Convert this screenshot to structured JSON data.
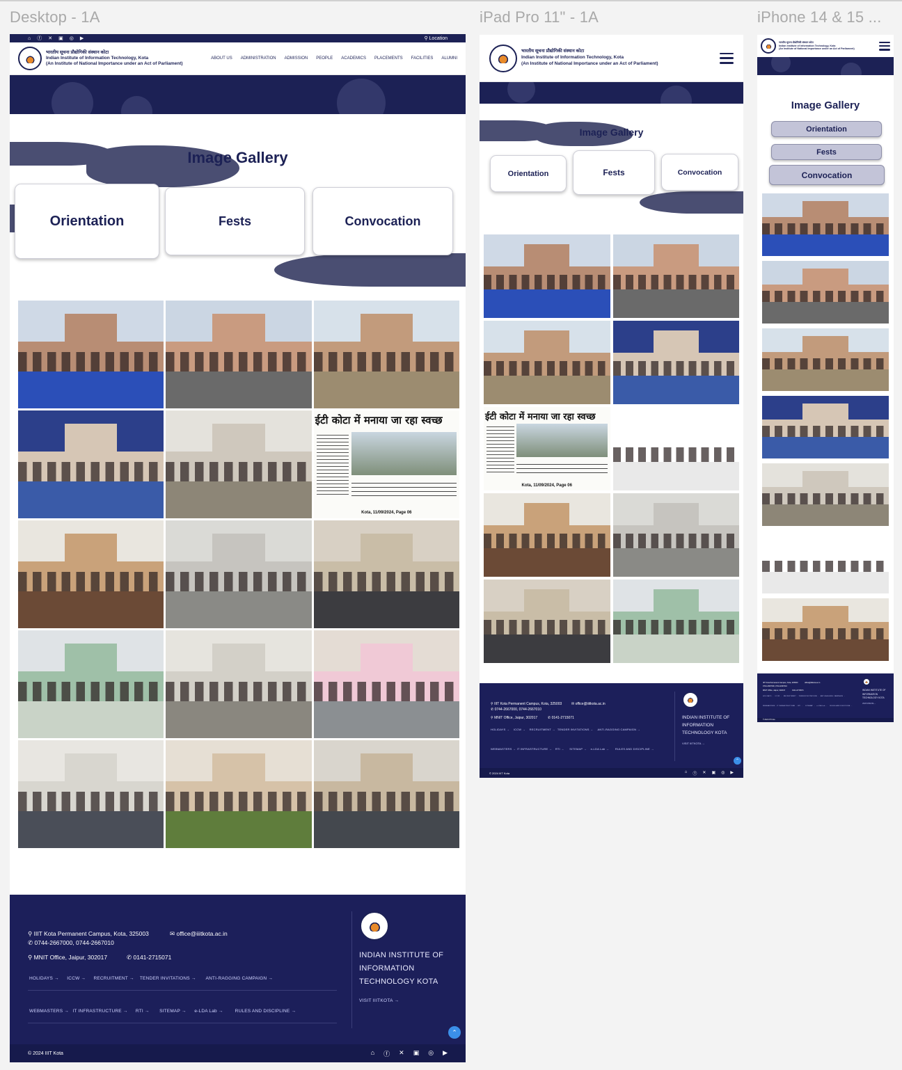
{
  "frames": {
    "desktop": "Desktop - 1A",
    "ipad": "iPad Pro 11\" - 1A",
    "iphone": "iPhone 14 & 15 ..."
  },
  "topbar": {
    "location": "Location"
  },
  "institute": {
    "hindi": "भारतीय सूचना प्रौद्योगिकी संस्थान कोटा",
    "english": "Indian Institute of Information Technology, Kota",
    "tagline": "(An Institute of National Importance under an Act of Parliament)"
  },
  "nav": [
    "ABOUT US",
    "ADMINISTRATION",
    "ADMISSION",
    "PEOPLE",
    "ACADEMICS",
    "PLACEMENTS",
    "FACILITIES",
    "ALUMNI"
  ],
  "gallery": {
    "title": "Image Gallery",
    "tabs": [
      "Orientation",
      "Fests",
      "Convocation"
    ]
  },
  "footer": {
    "address1": "IIIT Kota Permanent Campus, Kota, 325003",
    "email": "office@iiitkota.ac.in",
    "phone1": "0744-2667000, 0744-2667010",
    "address2": "MNIT Office, Jaipur, 302017",
    "phone2": "0141-2715071",
    "links1": [
      "HOLIDAYS →",
      "ICCW →",
      "RECRUITMENT →",
      "TENDER INVITATIONS →",
      "ANTI-RAGGING CAMPAIGN →"
    ],
    "links2": [
      "WEBMASTERS →",
      "IT INFRASTRUCTURE →",
      "RTI →",
      "SITEMAP →",
      "e-LDA Lab →",
      "RULES AND DISCIPLINE →"
    ],
    "brand_lines": [
      "INDIAN INSTITUTE OF",
      "INFORMATION",
      "TECHNOLOGY KOTA"
    ],
    "visit": "VISIT IIITKOTA →",
    "copyright": "© 2024 IIIT Kota"
  },
  "newspaper": {
    "headline": "ईटी कोटा में मनाया जा रहा स्वच्छ",
    "caption": "Kota, 11/09/2024, Page 06"
  },
  "icons": [
    "home-icon",
    "facebook-icon",
    "x-icon",
    "linkedin-icon",
    "instagram-icon",
    "youtube-icon"
  ],
  "colors": {
    "navy": "#1c2155",
    "footer": "#1c1f5a",
    "accent": "#3b8fe8",
    "blob": "#4a4e72"
  }
}
